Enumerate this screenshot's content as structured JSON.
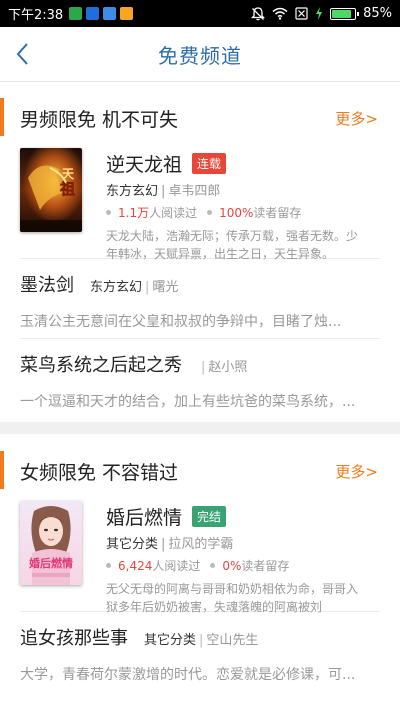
{
  "status": {
    "time": "下午2:38",
    "battery_pct": "85%",
    "battery_level": 0.85,
    "app_colors": [
      "#2aa84a",
      "#1e6fd9",
      "#3b8de8",
      "#f5a623"
    ]
  },
  "nav": {
    "title": "免费频道"
  },
  "male": {
    "title": "男频限免 机不可失",
    "more": "更多>",
    "feature": {
      "title": "逆天龙祖",
      "badge": "连载",
      "badge_color": "#e9463a",
      "category": "东方玄幻",
      "author": "卓韦四郎",
      "read_count": "1.1万",
      "read_suffix": "人阅读过",
      "retention": "100%",
      "retention_suffix": "读者留存",
      "desc": "天龙大陆，浩瀚无际；传承万载，强者无数。少年韩冰，天赋异禀，出生之日，天生异象。"
    },
    "items": [
      {
        "title": "墨法剑",
        "category": "东方玄幻",
        "author": "曙光",
        "desc": "玉清公主无意间在父皇和叔叔的争辩中，目睹了烛..."
      },
      {
        "title": "菜鸟系统之后起之秀",
        "category": "",
        "author": "赵小照",
        "desc": "一个逗逼和天才的结合，加上有些坑爸的菜鸟系统，..."
      }
    ]
  },
  "female": {
    "title": "女频限免 不容错过",
    "more": "更多>",
    "feature": {
      "title": "婚后燃情",
      "badge": "完结",
      "badge_color": "#3aa373",
      "category": "其它分类",
      "author": "拉风的学霸",
      "read_count": "6,424",
      "read_suffix": "人阅读过",
      "retention": "0%",
      "retention_suffix": "读者留存",
      "desc": "无父无母的阿离与哥哥和奶奶相依为命，哥哥入狱多年后奶奶被害，失魂落魄的阿离被刘"
    },
    "items": [
      {
        "title": "追女孩那些事",
        "category": "其它分类",
        "author": "空山先生",
        "desc": "大学，青春荷尔蒙激增的时代。恋爱就是必修课，可..."
      }
    ]
  }
}
